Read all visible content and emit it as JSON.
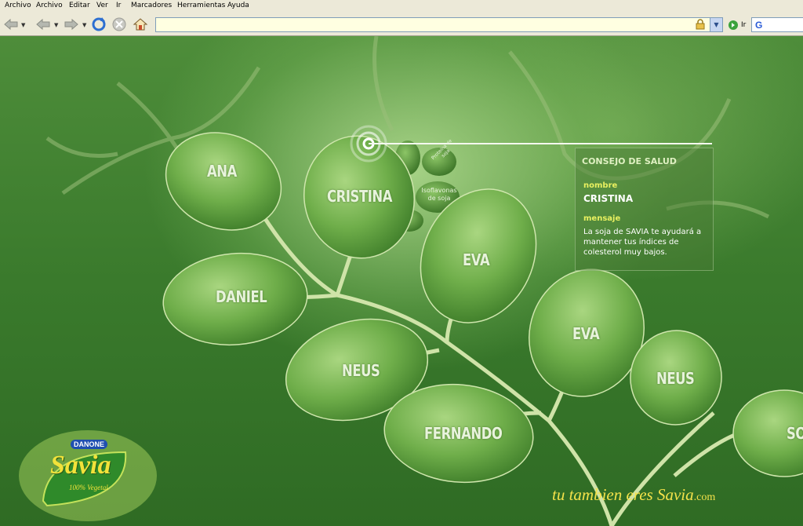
{
  "menu": [
    "Archivo",
    "Archivo",
    "Editar",
    "Ver",
    "Ir",
    "Marcadores",
    "Herramientas",
    "Ayuda"
  ],
  "toolbar": {
    "go_label": "Ir"
  },
  "address": {
    "value": "",
    "placeholder": ""
  },
  "leaves": {
    "ana": "ANA",
    "cristina": "CRISTINA",
    "daniel": "DANIEL",
    "eva1": "EVA",
    "eva2": "EVA",
    "neus1": "NEUS",
    "neus2": "NEUS",
    "fernando": "FERNANDO",
    "partial": "SO"
  },
  "small_leaves": {
    "isoflavonas": "Isoflavonas de soja",
    "proteina": "Proteína de soja"
  },
  "panel": {
    "title": "CONSEJO DE SALUD",
    "name_label": "nombre",
    "name": "CRISTINA",
    "msg_label": "mensaje",
    "message": "La soja de SAVIA te ayudará a mantener tus índices de colesterol muy bajos."
  },
  "brand": {
    "company": "DANONE",
    "name": "Savia",
    "sub": "100% Vegetal",
    "tagline_main": "tu tambien eres Savia",
    "tagline_com": ".com"
  },
  "colors": {
    "accent": "#f4e24a",
    "panel_label": "#e9f060",
    "leaf": "#6fae4a"
  }
}
